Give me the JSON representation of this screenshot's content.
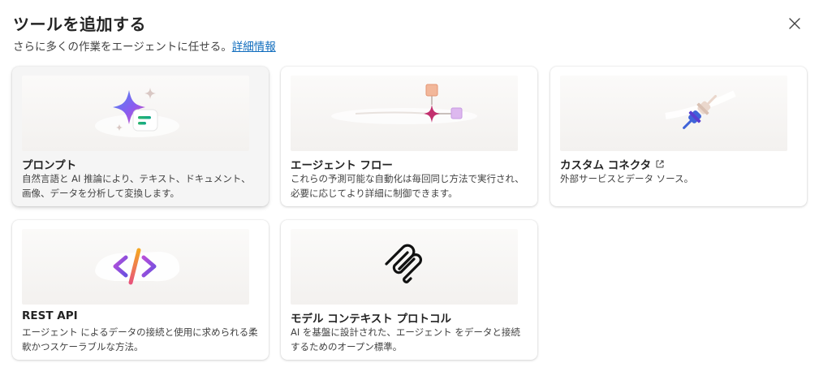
{
  "dialog": {
    "title": "ツールを追加する",
    "subtitle": "さらに多くの作業をエージェントに任せる。",
    "subtitle_link": "詳細情報",
    "close_icon": "close-icon"
  },
  "cards": [
    {
      "id": "prompt",
      "title": "プロンプト",
      "description": "自然言語と AI 推論により、テキスト、ドキュメント、画像、データを分析して変換します。",
      "icon": "sparkle-icon",
      "selected": true
    },
    {
      "id": "flow",
      "title": "エージェント フロー",
      "description": "これらの予測可能な自動化は毎回同じ方法で実行され、必要に応じてより詳細に制御できます。",
      "icon": "flow-icon",
      "selected": false
    },
    {
      "id": "connector",
      "title": "カスタム コネクタ",
      "description": "外部サービスとデータ ソース。",
      "icon": "plug-icon",
      "external_icon": "open-external-icon",
      "selected": false
    },
    {
      "id": "rest",
      "title": "REST API",
      "description": "エージェント によるデータの接続と使用に求められる柔軟かつスケーラブルな方法。",
      "icon": "code-icon",
      "selected": false
    },
    {
      "id": "mcp",
      "title": "モデル コンテキスト プロトコル",
      "description": "AI を基盤に設計された、エージェント をデータと接続するためのオープン標準。",
      "icon": "mcp-icon",
      "selected": false
    }
  ],
  "colors": {
    "link": "#0f6cbd",
    "selected_card_bg": "#f5f5f5",
    "card_bg": "#ffffff"
  }
}
